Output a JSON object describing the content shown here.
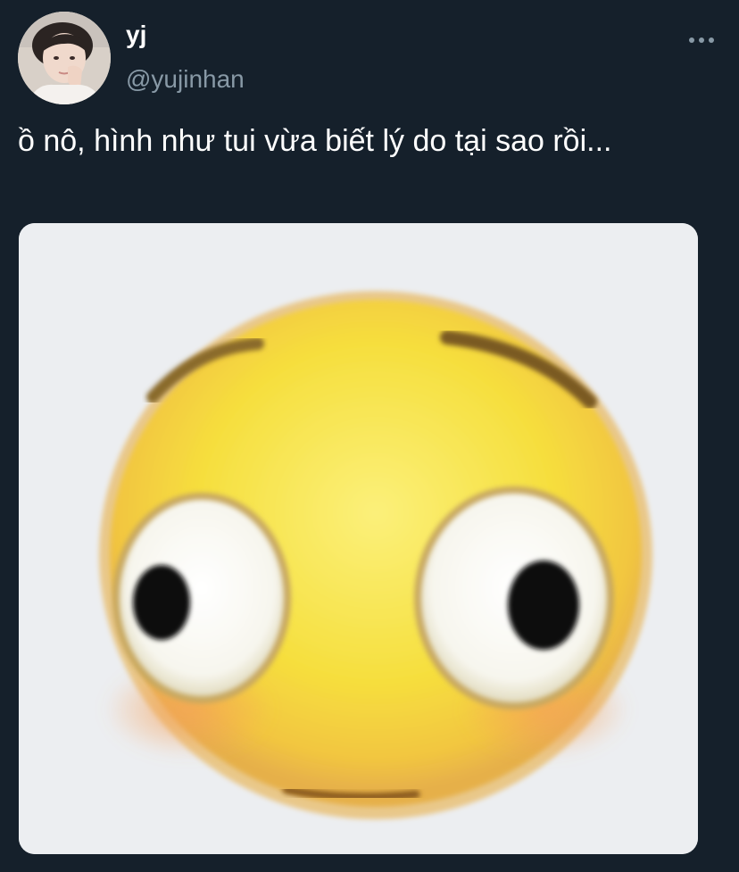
{
  "tweet": {
    "display_name": "yj",
    "handle": "@yujinhan",
    "text": "ồ nô, hình như tui vừa biết lý do tại sao rồi...",
    "avatar_icon": "profile-photo",
    "more_icon": "more-horizontal-icon",
    "media_description_icon": "flushed-emoji-image"
  },
  "theme": {
    "background": "#15202b",
    "primary_text": "#ffffff",
    "secondary_text": "#8899a6",
    "media_background": "#eceef1",
    "emoji_yellow": "#f7e046"
  }
}
